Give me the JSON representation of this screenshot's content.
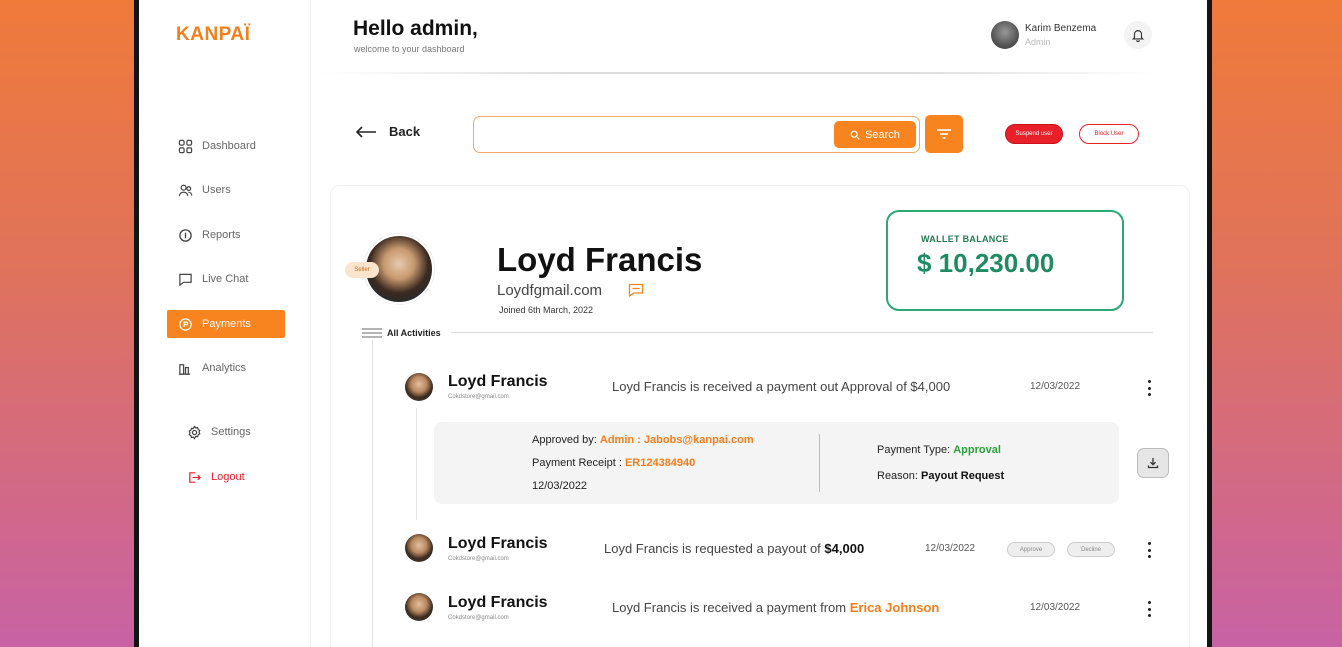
{
  "app": {
    "logo": "KANPAÏ",
    "brand_color": "#f7841e"
  },
  "sidebar": {
    "items": [
      {
        "label": "Dashboard",
        "icon": "grid-icon"
      },
      {
        "label": "Users",
        "icon": "users-icon"
      },
      {
        "label": "Reports",
        "icon": "info-icon"
      },
      {
        "label": "Live Chat",
        "icon": "chat-icon"
      },
      {
        "label": "Payments",
        "icon": "payment-icon",
        "active": true
      },
      {
        "label": "Analytics",
        "icon": "analytics-icon"
      },
      {
        "label": "Settings",
        "icon": "gear-icon"
      },
      {
        "label": "Logout",
        "icon": "logout-icon"
      }
    ]
  },
  "header": {
    "greeting": "Hello admin,",
    "subtitle": "welcome to your dashboard",
    "user_name": "Karim Benzema",
    "user_role": "Admin"
  },
  "toolbar": {
    "back_label": "Back",
    "search_placeholder": "",
    "search_value": "",
    "search_label": "Search",
    "suspend_label": "Suspend user",
    "block_label": "Block User"
  },
  "profile": {
    "badge": "Seller",
    "name": "Loyd Francis",
    "email": "Loydfgmail.com",
    "joined": "Joined 6th March, 2022"
  },
  "wallet": {
    "label": "WALLET BALANCE",
    "amount": "$ 10,230.00"
  },
  "activities": {
    "label": "All Activities",
    "items": [
      {
        "name": "Loyd Francis",
        "email": "Cokdstore@gmail.com",
        "desc": "Loyd Francis is received a payment out Approval of $4,000",
        "date": "12/03/2022",
        "detail": {
          "approved_by_label": "Approved by:",
          "approved_by_value": "Admin : Jabobs@kanpai.com",
          "receipt_label": "Payment Receipt :",
          "receipt_value": "ER124384940",
          "date": "12/03/2022",
          "type_label": "Payment Type:",
          "type_value": "Approval",
          "reason_label": "Reason:",
          "reason_value": "Payout Request"
        }
      },
      {
        "name": "Loyd Francis",
        "email": "Cokdstore@gmail.com",
        "desc_prefix": "Loyd Francis is requested a payout of",
        "desc_amount": "$4,000",
        "date": "12/03/2022",
        "approve_label": "Approve",
        "decline_label": "Decline"
      },
      {
        "name": "Loyd Francis",
        "email": "Cokdstore@gmail.com",
        "desc_prefix": "Loyd Francis is received a payment from",
        "desc_from": "Erica Johnson",
        "date": "12/03/2022"
      }
    ]
  }
}
